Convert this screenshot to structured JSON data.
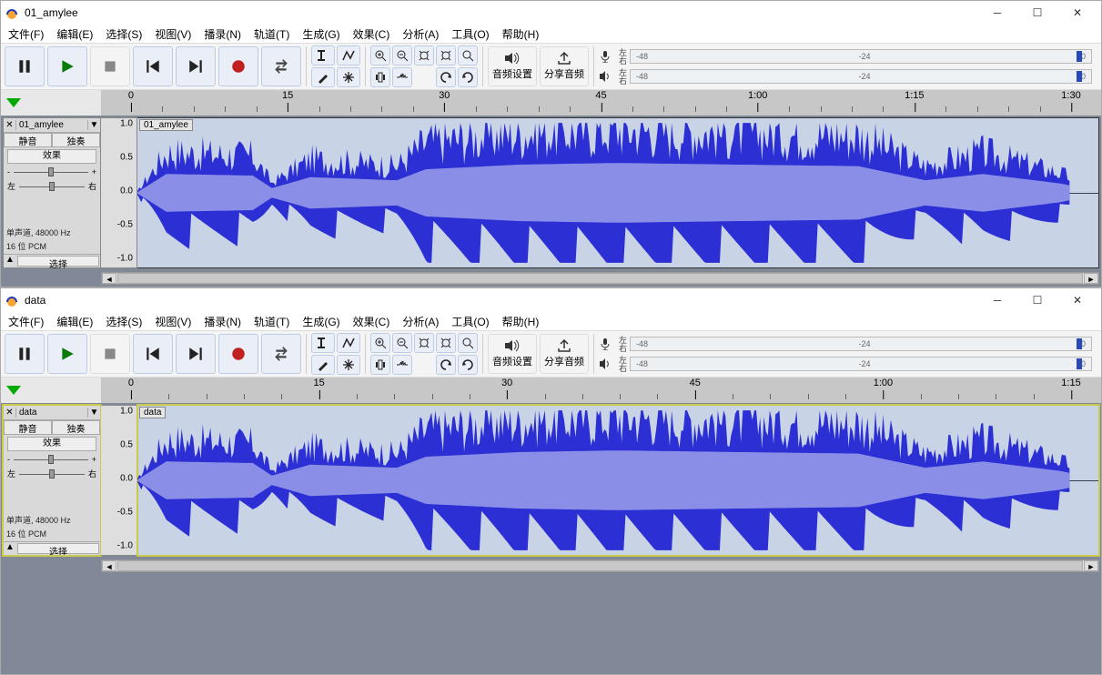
{
  "windows": [
    {
      "title": "01_amylee",
      "track_name": "01_amylee",
      "clip_name": "01_amylee",
      "ruler": [
        "0",
        "15",
        "30",
        "45",
        "1:00",
        "1:15",
        "1:30"
      ],
      "selected": false
    },
    {
      "title": "data",
      "track_name": "data",
      "clip_name": "data",
      "ruler": [
        "0",
        "15",
        "30",
        "45",
        "1:00",
        "1:15"
      ],
      "selected": true
    }
  ],
  "menu": {
    "file": "文件(F)",
    "edit": "编辑(E)",
    "select": "选择(S)",
    "view": "视图(V)",
    "transport": "播录(N)",
    "tracks": "轨道(T)",
    "generate": "生成(G)",
    "effect": "效果(C)",
    "analyze": "分析(A)",
    "tools": "工具(O)",
    "help": "帮助(H)"
  },
  "toolbar": {
    "audio_setup": "音频设置",
    "share": "分享音频"
  },
  "meter": {
    "ticks": [
      "-48",
      "-24",
      "0"
    ],
    "lr_top": "左右",
    "lr_bot": "左右"
  },
  "tcp": {
    "mute": "静音",
    "solo": "独奏",
    "fx": "效果",
    "minus": "-",
    "plus": "+",
    "l": "左",
    "r": "右",
    "fmt1": "单声道, 48000 Hz",
    "fmt2": "16 位 PCM",
    "select": "选择"
  },
  "yaxis": [
    "1.0",
    "0.5",
    "0.0",
    "-0.5",
    "-1.0"
  ]
}
